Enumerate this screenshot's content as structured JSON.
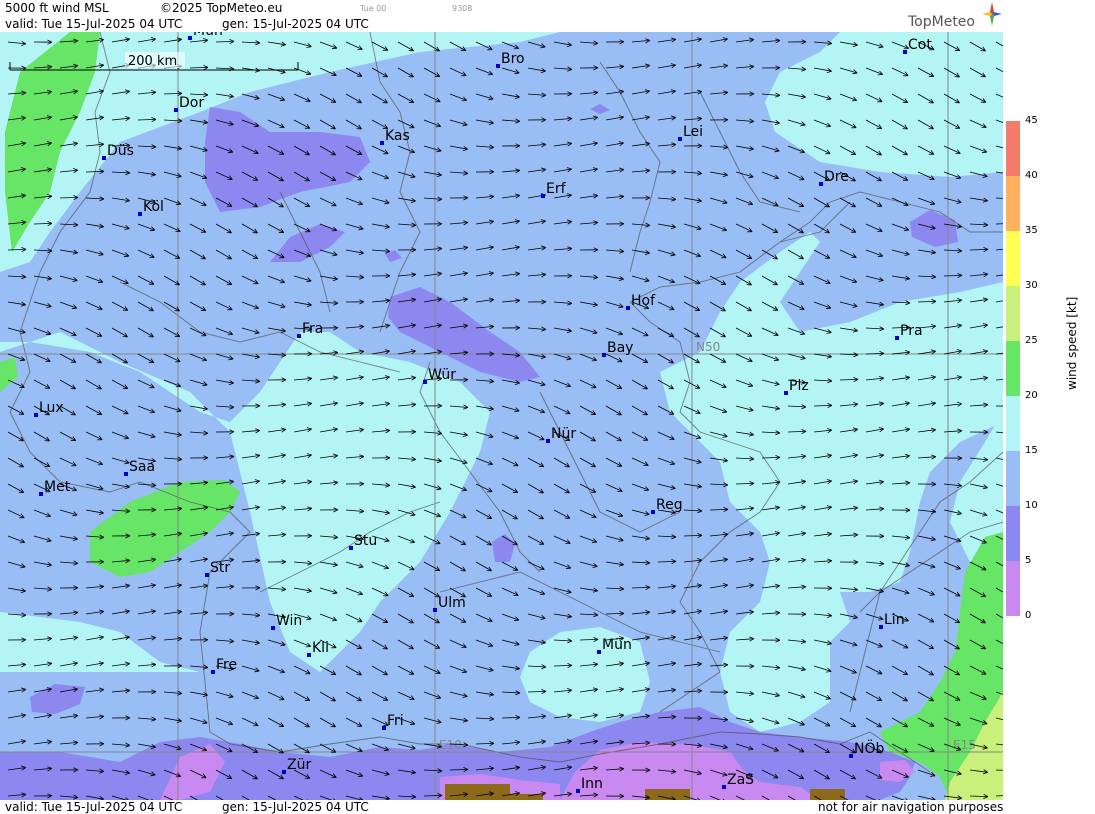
{
  "header": {
    "product": "5000 ft wind MSL",
    "copyright": "©2025 TopMeteo.eu",
    "run_small": "Tue 00",
    "code_small": "9308",
    "valid": "valid:  Tue  15-Jul-2025  04 UTC",
    "gen": "gen: 15-Jul-2025 04 UTC",
    "logo": "TopMeteo"
  },
  "footer": {
    "valid": "valid:  Tue  15-Jul-2025  04 UTC",
    "gen": "gen: 15-Jul-2025 04 UTC",
    "disclaimer": "not for air navigation purposes"
  },
  "scale_bar": {
    "label": "200 km"
  },
  "grid_labels": {
    "n50": "N50",
    "e10": "E10",
    "e15": "E15"
  },
  "legend": {
    "title": "wind speed [kt]",
    "ticks": [
      "45",
      "40",
      "35",
      "30",
      "25",
      "20",
      "15",
      "10",
      "5",
      "0"
    ],
    "colors": {
      "0-5": "#c889f0",
      "5-10": "#8c88ef",
      "10-15": "#99bdf5",
      "15-20": "#b3f5f5",
      "20-25": "#66e566",
      "25-30": "#c8f07a",
      "30-35": "#ffff55",
      "35-40": "#ffb060",
      "40-45": "#f47a6a"
    }
  },
  "cities": [
    {
      "name": "Mün",
      "id": "city-munster-top"
    },
    {
      "name": "Bro"
    },
    {
      "name": "Cot"
    },
    {
      "name": "Dor"
    },
    {
      "name": "Kas"
    },
    {
      "name": "Lei"
    },
    {
      "name": "Düs"
    },
    {
      "name": "Erf"
    },
    {
      "name": "Dre"
    },
    {
      "name": "Köl"
    },
    {
      "name": "Hof"
    },
    {
      "name": "Fra"
    },
    {
      "name": "Pra"
    },
    {
      "name": "Bay"
    },
    {
      "name": "Würz",
      "display": "Wür"
    },
    {
      "name": "Plz"
    },
    {
      "name": "Lux"
    },
    {
      "name": "Nür"
    },
    {
      "name": "Saa"
    },
    {
      "name": "Met"
    },
    {
      "name": "Reg"
    },
    {
      "name": "Stu"
    },
    {
      "name": "Str"
    },
    {
      "name": "Ulm"
    },
    {
      "name": "Win"
    },
    {
      "name": "Lin"
    },
    {
      "name": "Kli"
    },
    {
      "name": "Mün",
      "id": "city-munchen"
    },
    {
      "name": "Fre"
    },
    {
      "name": "Fri"
    },
    {
      "name": "NÖb"
    },
    {
      "name": "Zür"
    },
    {
      "name": "Inn"
    },
    {
      "name": "ZaS"
    }
  ]
}
